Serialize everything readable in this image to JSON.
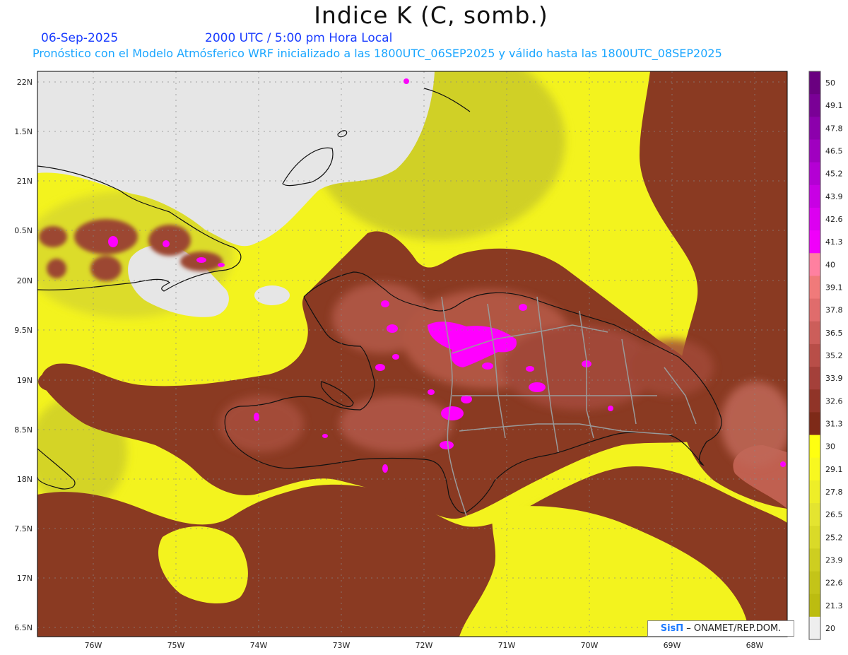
{
  "header": {
    "title": "Indice K (C, somb.)",
    "date": "06-Sep-2025",
    "time": "2000 UTC / 5:00 pm Hora Local",
    "forecast_line": "Pronóstico con el Modelo Atmósferico WRF inicializado a las 1800UTC_06SEP2025 y válido hasta las  1800UTC_08SEP2025"
  },
  "axes": {
    "lat_labels": [
      "22N",
      "1.5N",
      "21N",
      "0.5N",
      "20N",
      "9.5N",
      "19N",
      "8.5N",
      "18N",
      "7.5N",
      "17N",
      "6.5N"
    ],
    "lon_labels": [
      "76W",
      "75W",
      "74W",
      "73W",
      "72W",
      "71W",
      "70W",
      "69W",
      "68W"
    ]
  },
  "colorbar": {
    "labels": [
      "50",
      "49.1",
      "47.8",
      "46.5",
      "45.2",
      "43.9",
      "42.6",
      "41.3",
      "40",
      "39.1",
      "37.8",
      "36.5",
      "35.2",
      "33.9",
      "32.6",
      "31.3",
      "30",
      "29.1",
      "27.8",
      "26.5",
      "25.2",
      "23.9",
      "22.6",
      "21.3",
      "20"
    ],
    "colors": [
      "#6a0080",
      "#7a0096",
      "#8c00ac",
      "#a000c0",
      "#b400d4",
      "#c800e4",
      "#dc00f0",
      "#f000fa",
      "#ff80a0",
      "#f07a7a",
      "#e06c6c",
      "#cc5e5a",
      "#b84e48",
      "#a4403a",
      "#903428",
      "#7e2a18",
      "#ffff10",
      "#f8f820",
      "#eeee28",
      "#e4e430",
      "#dada28",
      "#cece20",
      "#c4c418",
      "#bcbc10",
      "#eeeeee"
    ]
  },
  "legend": {
    "brand": "SisΠ",
    "agency": " – ONAMET/REP.DOM."
  },
  "colors": {
    "land_dry": "#e8e800",
    "sea_yellow": "#f5f520",
    "brown": "#8a3a22",
    "magenta": "#ff00ff",
    "grey_land": "#e8e8e8"
  }
}
